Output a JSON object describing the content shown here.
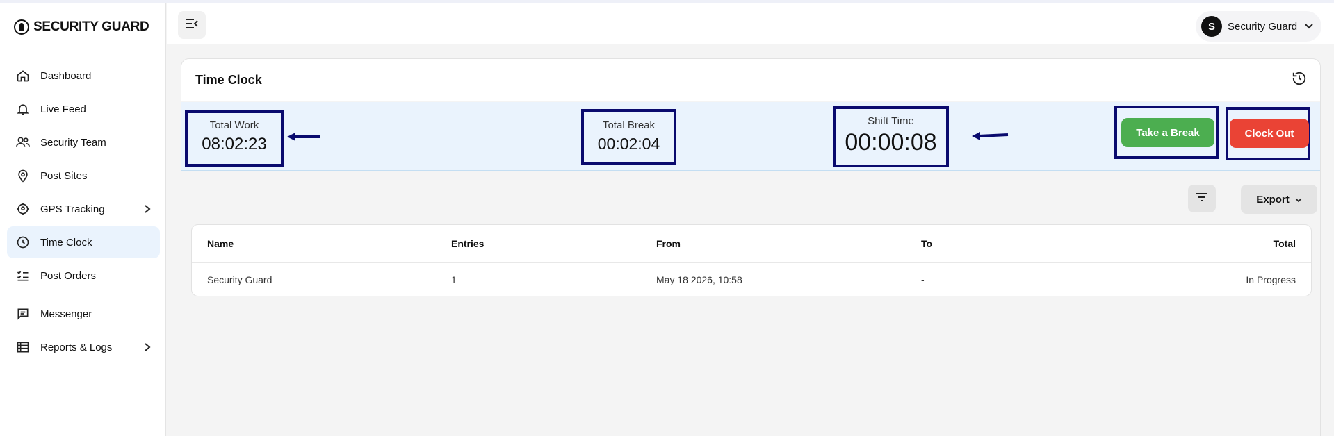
{
  "app": {
    "logo_text": "SECURITY GUARD"
  },
  "sidebar": {
    "items": [
      {
        "label": "Dashboard",
        "icon": "home-icon"
      },
      {
        "label": "Live Feed",
        "icon": "bell-icon"
      },
      {
        "label": "Security Team",
        "icon": "users-icon"
      },
      {
        "label": "Post Sites",
        "icon": "map-pin-icon"
      },
      {
        "label": "GPS Tracking",
        "icon": "gps-icon",
        "has_submenu": true
      },
      {
        "label": "Time Clock",
        "icon": "clock-icon",
        "active": true
      },
      {
        "label": "Post Orders",
        "icon": "checklist-icon"
      },
      {
        "label": "Messenger",
        "icon": "message-icon"
      },
      {
        "label": "Reports & Logs",
        "icon": "list-icon",
        "has_submenu": true
      }
    ]
  },
  "topbar": {
    "user": {
      "initial": "S",
      "name": "Security Guard"
    }
  },
  "page": {
    "title": "Time Clock",
    "stats": {
      "total_work": {
        "label": "Total Work",
        "value": "08:02:23"
      },
      "total_break": {
        "label": "Total Break",
        "value": "00:02:04"
      },
      "shift_time": {
        "label": "Shift Time",
        "value": "00:00:08"
      }
    },
    "buttons": {
      "take_break": "Take a Break",
      "clock_out": "Clock Out",
      "export": "Export"
    },
    "table": {
      "columns": [
        "Name",
        "Entries",
        "From",
        "To",
        "Total"
      ],
      "rows": [
        [
          "Security Guard",
          "1",
          "May 18 2026, 10:58",
          "-",
          "In Progress"
        ]
      ]
    }
  },
  "colors": {
    "accent_bg": "#eaf3fd",
    "annotation_border": "#0a0a6e",
    "break_button": "#4cae50",
    "clock_out_button": "#ea4335"
  }
}
